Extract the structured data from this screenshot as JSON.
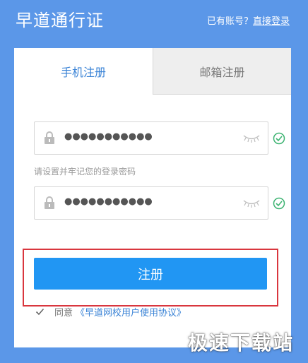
{
  "header": {
    "brand": "早道通行证",
    "login_prompt": "已有账号？",
    "login_link": "直接登录"
  },
  "tabs": [
    {
      "label": "手机注册",
      "active": true
    },
    {
      "label": "邮箱注册",
      "active": false
    }
  ],
  "form": {
    "password_mask": "●●●●●●●●●●●",
    "confirm_mask": "●●●●●●●●●●●",
    "password_hint": "请设置并牢记您的登录密码",
    "submit_label": "注册",
    "agree_prefix": "同意",
    "agree_link": "《早道网校用户使用协议》",
    "agree_checked": true
  },
  "watermark": "极速下载站",
  "colors": {
    "header_bg": "#5b97e8",
    "accent": "#2196f3",
    "link": "#3a83d6",
    "valid": "#3cb371",
    "highlight": "#d9363e"
  },
  "icons": [
    "lock-icon",
    "eye-closed-icon",
    "check-circle-icon",
    "checkbox-check-icon"
  ]
}
